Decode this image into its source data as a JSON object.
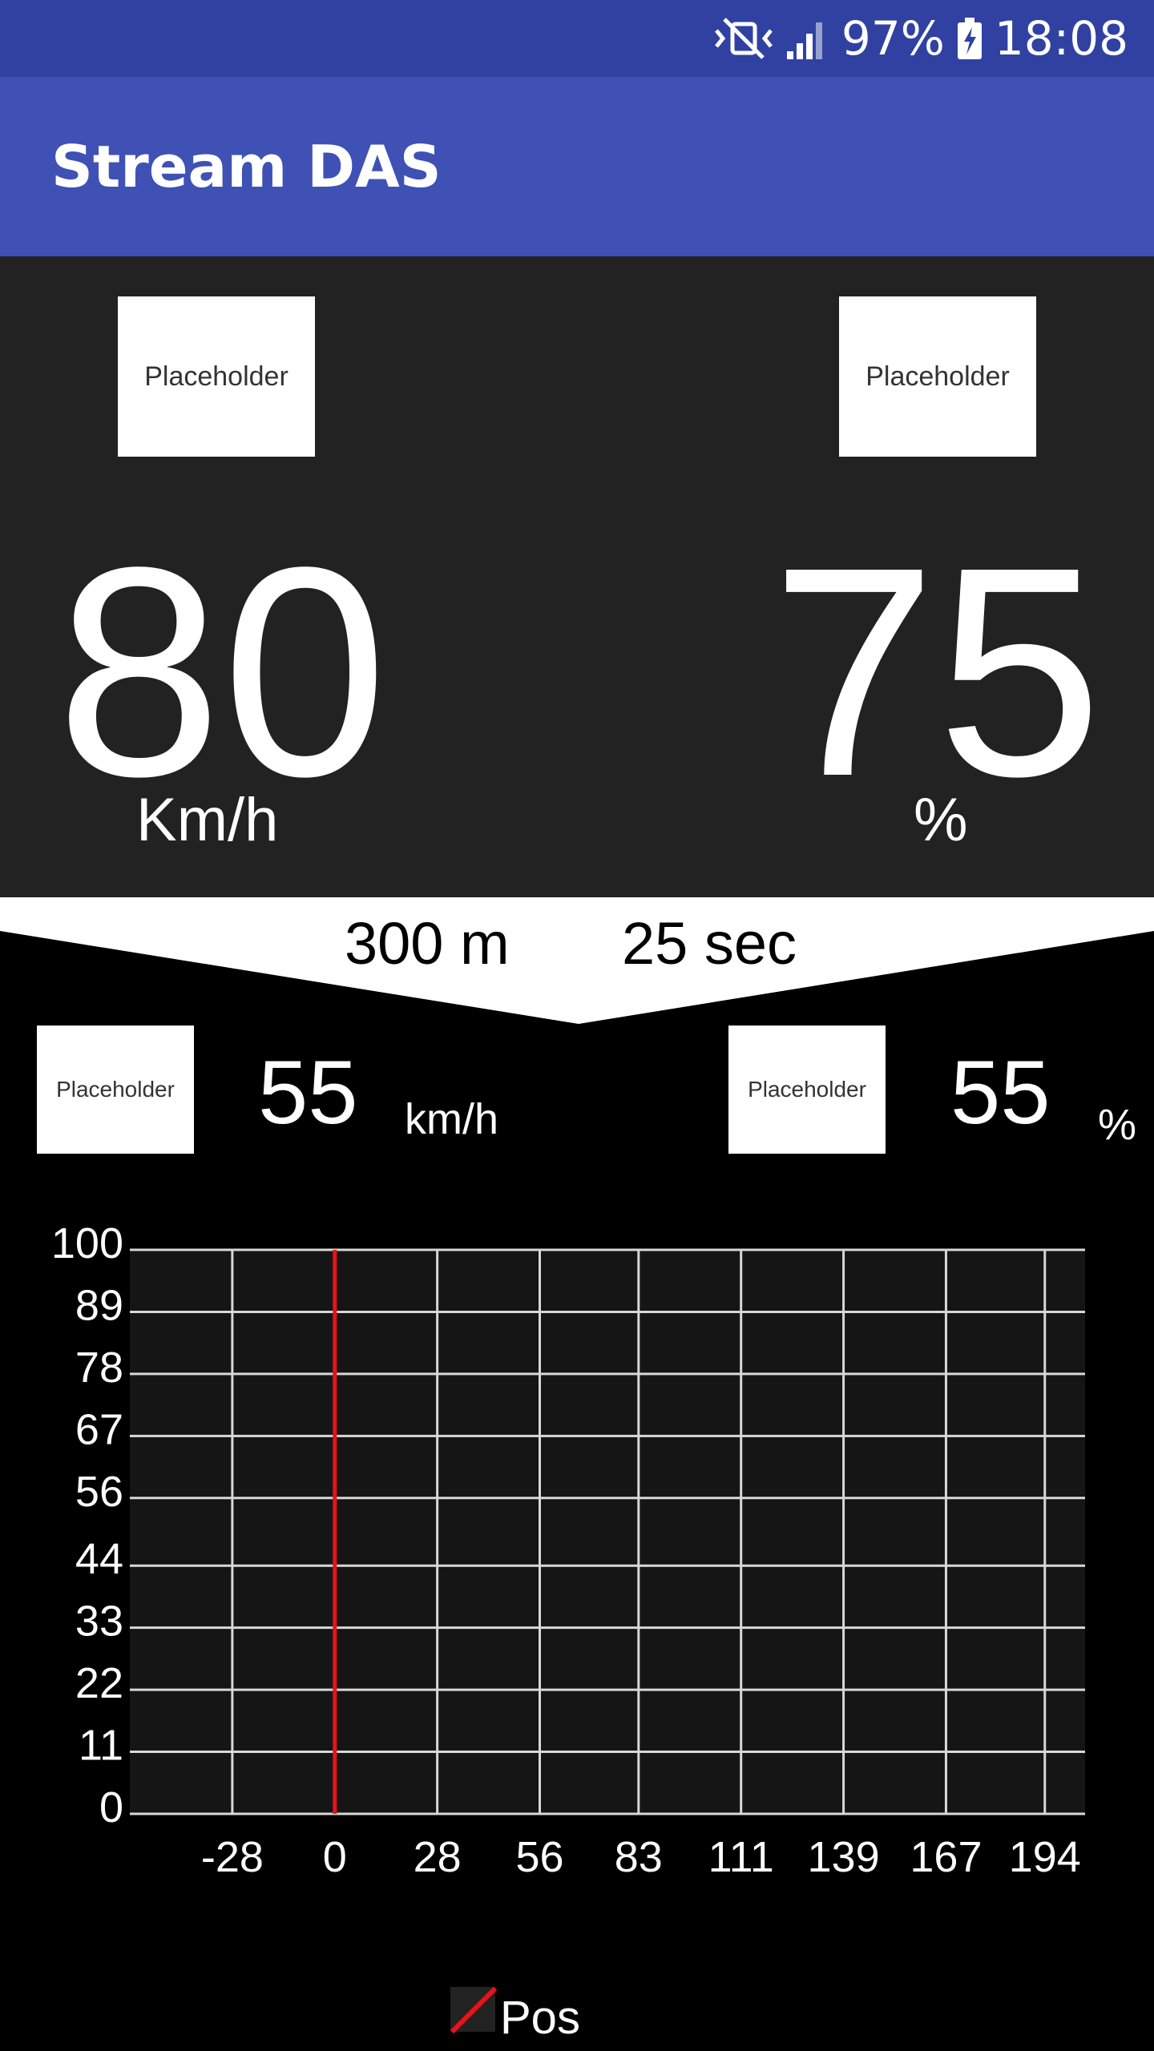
{
  "status_bar": {
    "battery": "97%",
    "time": "18:08",
    "icons": [
      "vibrate-icon",
      "signal-icon",
      "battery-charging-icon"
    ]
  },
  "app_bar": {
    "title": "Stream DAS"
  },
  "dashboard": {
    "left": {
      "image_label": "Placeholder",
      "value": "80",
      "unit": "Km/h"
    },
    "right": {
      "image_label": "Placeholder",
      "value": "75",
      "unit": "%"
    }
  },
  "banner": {
    "distance": "300 m",
    "time": "25 sec"
  },
  "secondary": {
    "left": {
      "image_label": "Placeholder",
      "value": "55",
      "unit": "km/h"
    },
    "right": {
      "image_label": "Placeholder",
      "value": "55",
      "unit": "%"
    }
  },
  "chart_data": {
    "type": "line",
    "x_ticks": [
      -28,
      0,
      28,
      56,
      83,
      111,
      139,
      167,
      194
    ],
    "y_ticks": [
      0,
      11,
      22,
      33,
      44,
      56,
      67,
      78,
      89,
      100
    ],
    "xlim": [
      -56,
      205
    ],
    "ylim": [
      0,
      100
    ],
    "grid": true,
    "legend_position": "bottom-center",
    "series": [
      {
        "name": "Pos",
        "color": "#e8121b",
        "x": [
          0,
          0
        ],
        "y": [
          0,
          100
        ]
      }
    ]
  }
}
